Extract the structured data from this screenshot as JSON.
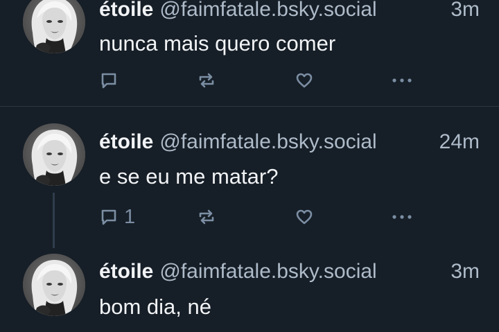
{
  "feed": {
    "posts": [
      {
        "display_name": "étoile",
        "handle": "@faimfatale.bsky.social",
        "time": "3m",
        "text": "nunca mais quero comer",
        "reply_count": ""
      },
      {
        "display_name": "étoile",
        "handle": "@faimfatale.bsky.social",
        "time": "24m",
        "text": "e se eu me matar?",
        "reply_count": "1"
      },
      {
        "display_name": "étoile",
        "handle": "@faimfatale.bsky.social",
        "time": "3m",
        "text": "bom dia, né",
        "reply_count": ""
      }
    ]
  },
  "icons": {
    "reply": "reply-icon",
    "repost": "repost-icon",
    "like": "heart-icon",
    "more": "more-options-icon"
  },
  "colors": {
    "background": "#161e27",
    "text": "#f1f3f5",
    "muted_text": "#aebbc9",
    "icon": "#7b8ea3",
    "divider": "#2b3744"
  }
}
